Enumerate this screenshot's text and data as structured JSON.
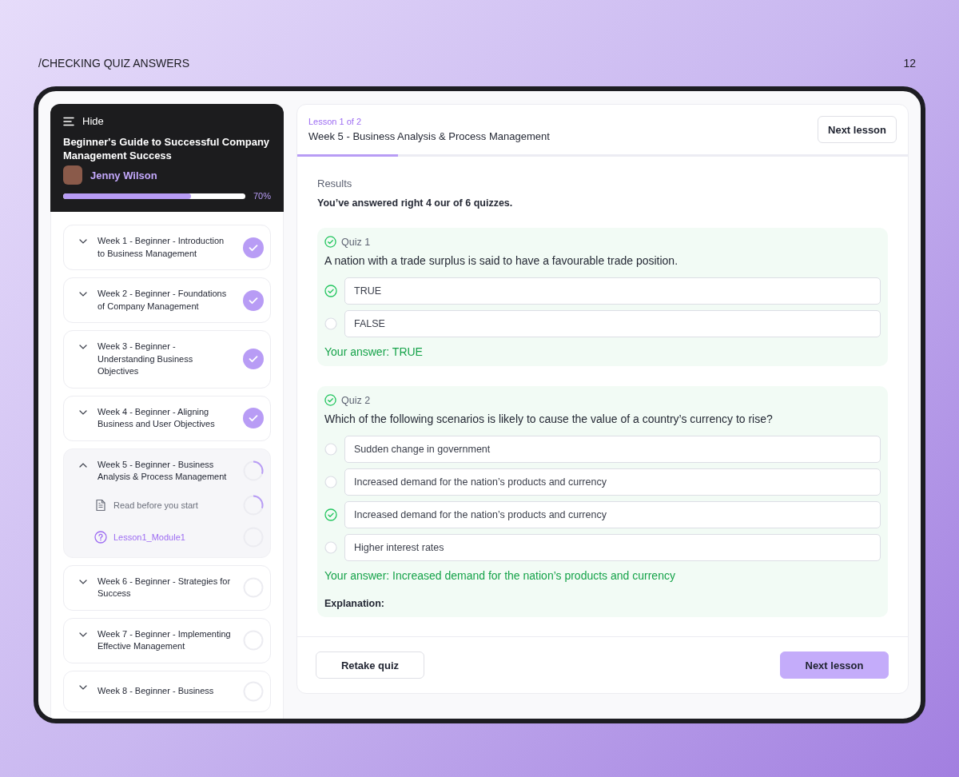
{
  "page_header": {
    "title": "/CHECKING QUIZ ANSWERS",
    "page_number": "12"
  },
  "sidebar": {
    "hide_label": "Hide",
    "course_title": "Beginner's Guide to Successful Company Management Success",
    "author": "Jenny Wilson",
    "progress": {
      "level": 0.7,
      "reading": "70%"
    },
    "weeks": [
      {
        "title": "Week 1 - Beginner - Introduction to Business Management",
        "expanded": false,
        "completed": true
      },
      {
        "title": "Week 2 - Beginner - Foundations of Company Management",
        "expanded": false,
        "completed": true
      },
      {
        "title": "Week 3 - Beginner - Understanding Business Objectives",
        "expanded": false,
        "completed": true
      },
      {
        "title": "Week 4 - Beginner - Aligning Business and User Objectives",
        "expanded": false,
        "completed": true
      },
      {
        "title": "Week 5 - Beginner - Business Analysis & Process Management",
        "expanded": true,
        "completed": false,
        "in_progress": true,
        "children": [
          {
            "title": "Read before you start",
            "kind": "reading",
            "selected": false,
            "completed": false,
            "in_progress": true
          },
          {
            "title": "Lesson1_Module1",
            "kind": "quiz",
            "selected": true,
            "completed": false,
            "in_progress": false
          }
        ]
      },
      {
        "title": "Week 6 - Beginner - Strategies for Success",
        "expanded": false,
        "completed": false,
        "in_progress": false
      },
      {
        "title": "Week 7 - Beginner - Implementing Effective Management",
        "expanded": false,
        "completed": false,
        "in_progress": false
      },
      {
        "title": "Week 8 - Beginner - Business",
        "expanded": false,
        "completed": false,
        "in_progress": false
      }
    ]
  },
  "lesson": {
    "counter": "Lesson 1 of 2",
    "title": "Week 5 - Business Analysis & Process Management",
    "next_button": "Next lesson",
    "progress": {
      "level": 0.165
    }
  },
  "results": {
    "label": "Results",
    "summary": "You’ve answered right 4 our of 6 quizzes.",
    "quizzes": [
      {
        "label": "Quiz 1",
        "correct": true,
        "question": "A nation with a trade surplus is said to have a favourable trade position.",
        "options": [
          {
            "text": "TRUE",
            "selected": true
          },
          {
            "text": "FALSE",
            "selected": false
          }
        ],
        "answer": "Your answer: TRUE"
      },
      {
        "label": "Quiz 2",
        "correct": true,
        "question": "Which of the following scenarios is likely to cause the value of a country’s currency to rise?",
        "options": [
          {
            "text": "Sudden change in government",
            "selected": false
          },
          {
            "text": "Increased demand for the nation’s products and currency",
            "selected": false
          },
          {
            "text": "Increased demand for the nation’s products and currency",
            "selected": true
          },
          {
            "text": "Higher interest rates",
            "selected": false
          }
        ],
        "answer": "Your answer: Increased demand for the nation’s products and currency",
        "explanation_label": "Explanation:"
      }
    ]
  },
  "footer": {
    "retake_button": "Retake quiz",
    "next_button": "Next lesson"
  }
}
